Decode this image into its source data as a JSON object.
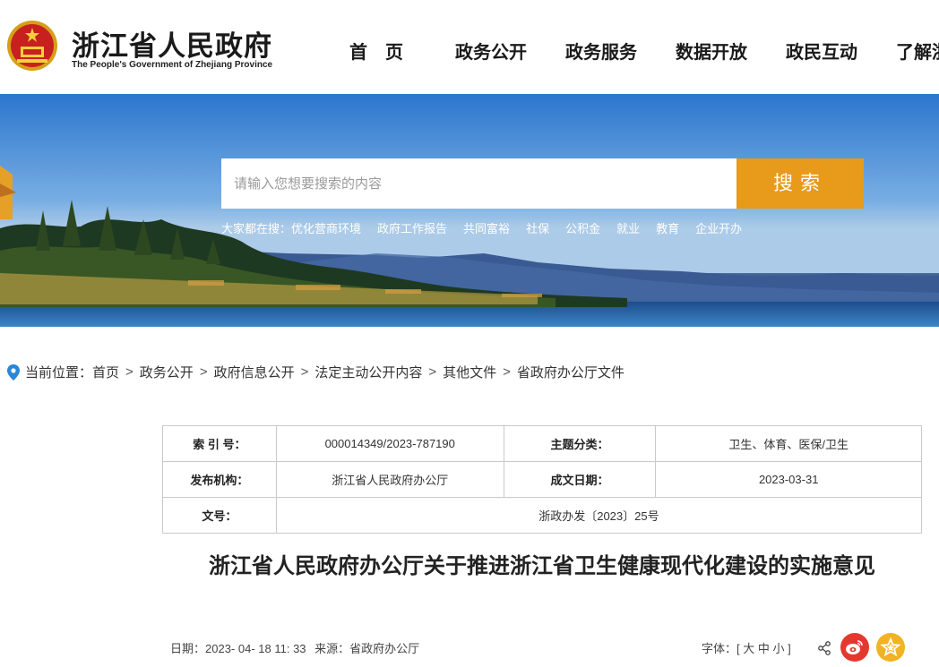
{
  "header": {
    "title": "浙江省人民政府",
    "subtitle": "The People's Government of Zhejiang Province",
    "nav": [
      "首　页",
      "政务公开",
      "政务服务",
      "数据开放",
      "政民互动",
      "了解浙"
    ]
  },
  "search": {
    "placeholder": "请输入您想要搜索的内容",
    "button": "搜索",
    "hot_label": "大家都在搜：",
    "hot_items": [
      "优化营商环境",
      "政府工作报告",
      "共同富裕",
      "社保",
      "公积金",
      "就业",
      "教育",
      "企业开办"
    ]
  },
  "breadcrumb": {
    "label": "当前位置：",
    "items": [
      "首页",
      "政务公开",
      "政府信息公开",
      "法定主动公开内容",
      "其他文件",
      "省政府办公厅文件"
    ],
    "separator": ">"
  },
  "meta": {
    "index_label": "索 引 号：",
    "index_value": "000014349/2023-787190",
    "topic_label": "主题分类：",
    "topic_value": "卫生、体育、医保/卫生",
    "org_label": "发布机构：",
    "org_value": "浙江省人民政府办公厅",
    "date_label": "成文日期：",
    "date_value": "2023-03-31",
    "docno_label": "文号：",
    "docno_value": "浙政办发〔2023〕25号"
  },
  "document": {
    "title": "浙江省人民政府办公厅关于推进浙江省卫生健康现代化建设的实施意见",
    "date_label": "日期：",
    "date": "2023- 04- 18 11: 33",
    "source_label": "来源：",
    "source": "省政府办公厅"
  },
  "font_size": {
    "label": "字体：[",
    "large": "大",
    "medium": "中",
    "small": "小",
    "close": "]"
  },
  "colors": {
    "accent": "#e89a1a",
    "weibo": "#e6372f",
    "favorite": "#f0b323"
  },
  "icons": [
    "national-emblem-icon",
    "location-pin-icon",
    "share-icon",
    "weibo-icon",
    "favorite-star-icon"
  ]
}
